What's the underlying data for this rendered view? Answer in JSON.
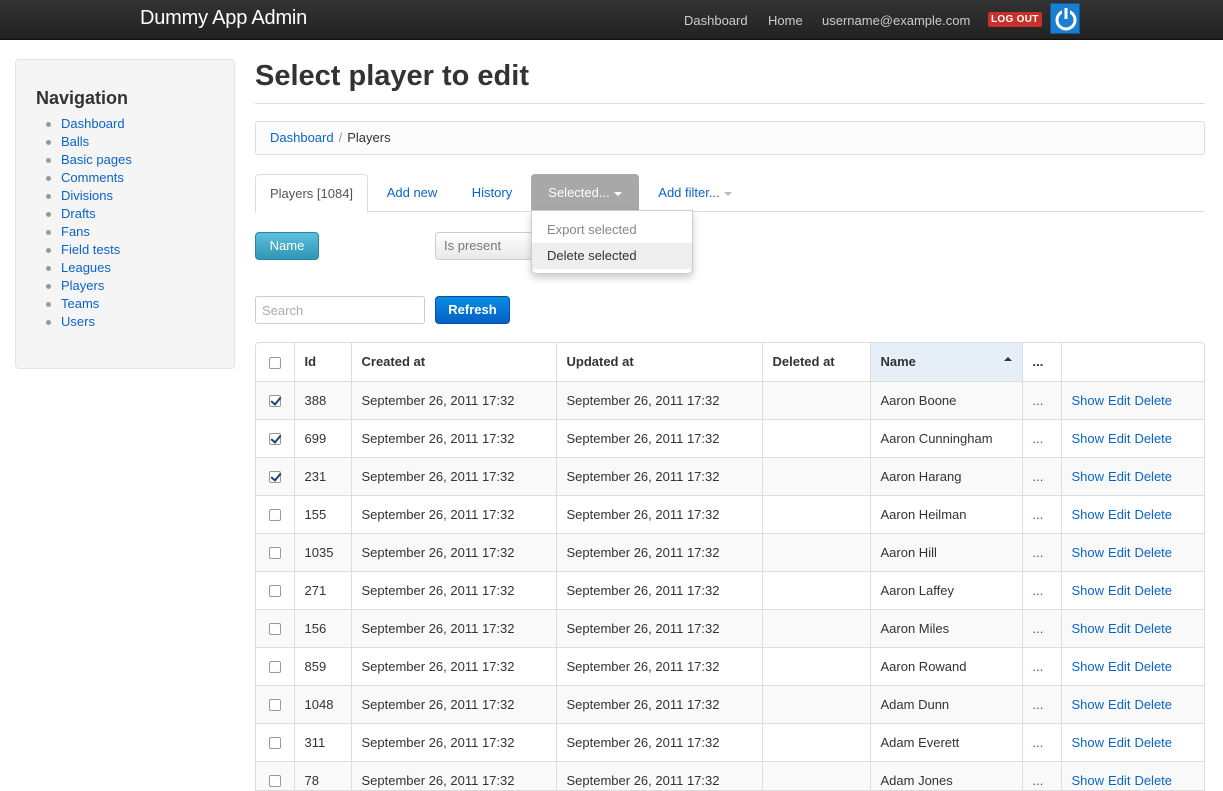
{
  "app": {
    "title": "Dummy App Admin"
  },
  "topnav": {
    "items": [
      "Dashboard",
      "Home",
      "username@example.com"
    ],
    "logout_label": "LOG OUT"
  },
  "sidebar": {
    "heading": "Navigation",
    "items": [
      "Dashboard",
      "Balls",
      "Basic pages",
      "Comments",
      "Divisions",
      "Drafts",
      "Fans",
      "Field tests",
      "Leagues",
      "Players",
      "Teams",
      "Users"
    ]
  },
  "page": {
    "title": "Select player to edit"
  },
  "breadcrumb": {
    "items": [
      "Dashboard",
      "Players"
    ],
    "separator": "/"
  },
  "tabs": {
    "players": "Players [1084]",
    "add_new": "Add new",
    "history": "History",
    "selected": "Selected...",
    "add_filter": "Add filter..."
  },
  "selected_menu": {
    "items": [
      "Export selected",
      "Delete selected"
    ]
  },
  "filter": {
    "field_label": "Name",
    "operator_value": "Is present"
  },
  "search": {
    "placeholder": "Search",
    "value": "",
    "refresh_label": "Refresh"
  },
  "table": {
    "columns": [
      "Id",
      "Created at",
      "Updated at",
      "Deleted at",
      "Name",
      "..."
    ],
    "sorted_column": "Name",
    "actions": [
      "Show",
      "Edit",
      "Delete"
    ],
    "rows": [
      {
        "checked": true,
        "id": "388",
        "created": "September 26, 2011 17:32",
        "updated": "September 26, 2011 17:32",
        "deleted": "",
        "name": "Aaron Boone",
        "more": "..."
      },
      {
        "checked": true,
        "id": "699",
        "created": "September 26, 2011 17:32",
        "updated": "September 26, 2011 17:32",
        "deleted": "",
        "name": "Aaron Cunningham",
        "more": "..."
      },
      {
        "checked": true,
        "id": "231",
        "created": "September 26, 2011 17:32",
        "updated": "September 26, 2011 17:32",
        "deleted": "",
        "name": "Aaron Harang",
        "more": "..."
      },
      {
        "checked": false,
        "id": "155",
        "created": "September 26, 2011 17:32",
        "updated": "September 26, 2011 17:32",
        "deleted": "",
        "name": "Aaron Heilman",
        "more": "..."
      },
      {
        "checked": false,
        "id": "1035",
        "created": "September 26, 2011 17:32",
        "updated": "September 26, 2011 17:32",
        "deleted": "",
        "name": "Aaron Hill",
        "more": "..."
      },
      {
        "checked": false,
        "id": "271",
        "created": "September 26, 2011 17:32",
        "updated": "September 26, 2011 17:32",
        "deleted": "",
        "name": "Aaron Laffey",
        "more": "..."
      },
      {
        "checked": false,
        "id": "156",
        "created": "September 26, 2011 17:32",
        "updated": "September 26, 2011 17:32",
        "deleted": "",
        "name": "Aaron Miles",
        "more": "..."
      },
      {
        "checked": false,
        "id": "859",
        "created": "September 26, 2011 17:32",
        "updated": "September 26, 2011 17:32",
        "deleted": "",
        "name": "Aaron Rowand",
        "more": "..."
      },
      {
        "checked": false,
        "id": "1048",
        "created": "September 26, 2011 17:32",
        "updated": "September 26, 2011 17:32",
        "deleted": "",
        "name": "Adam Dunn",
        "more": "..."
      },
      {
        "checked": false,
        "id": "311",
        "created": "September 26, 2011 17:32",
        "updated": "September 26, 2011 17:32",
        "deleted": "",
        "name": "Adam Everett",
        "more": "..."
      },
      {
        "checked": false,
        "id": "78",
        "created": "September 26, 2011 17:32",
        "updated": "September 26, 2011 17:32",
        "deleted": "",
        "name": "Adam Jones",
        "more": "..."
      }
    ]
  },
  "colors": {
    "link": "#0a64c8",
    "topbar": "#222222",
    "info_button": "#2f96b4",
    "primary_button": "#0560c8",
    "logout": "#c8302b"
  },
  "icons": {
    "power": "power-icon",
    "sort": "sort-ascending-icon",
    "caret": "caret-down-icon"
  }
}
